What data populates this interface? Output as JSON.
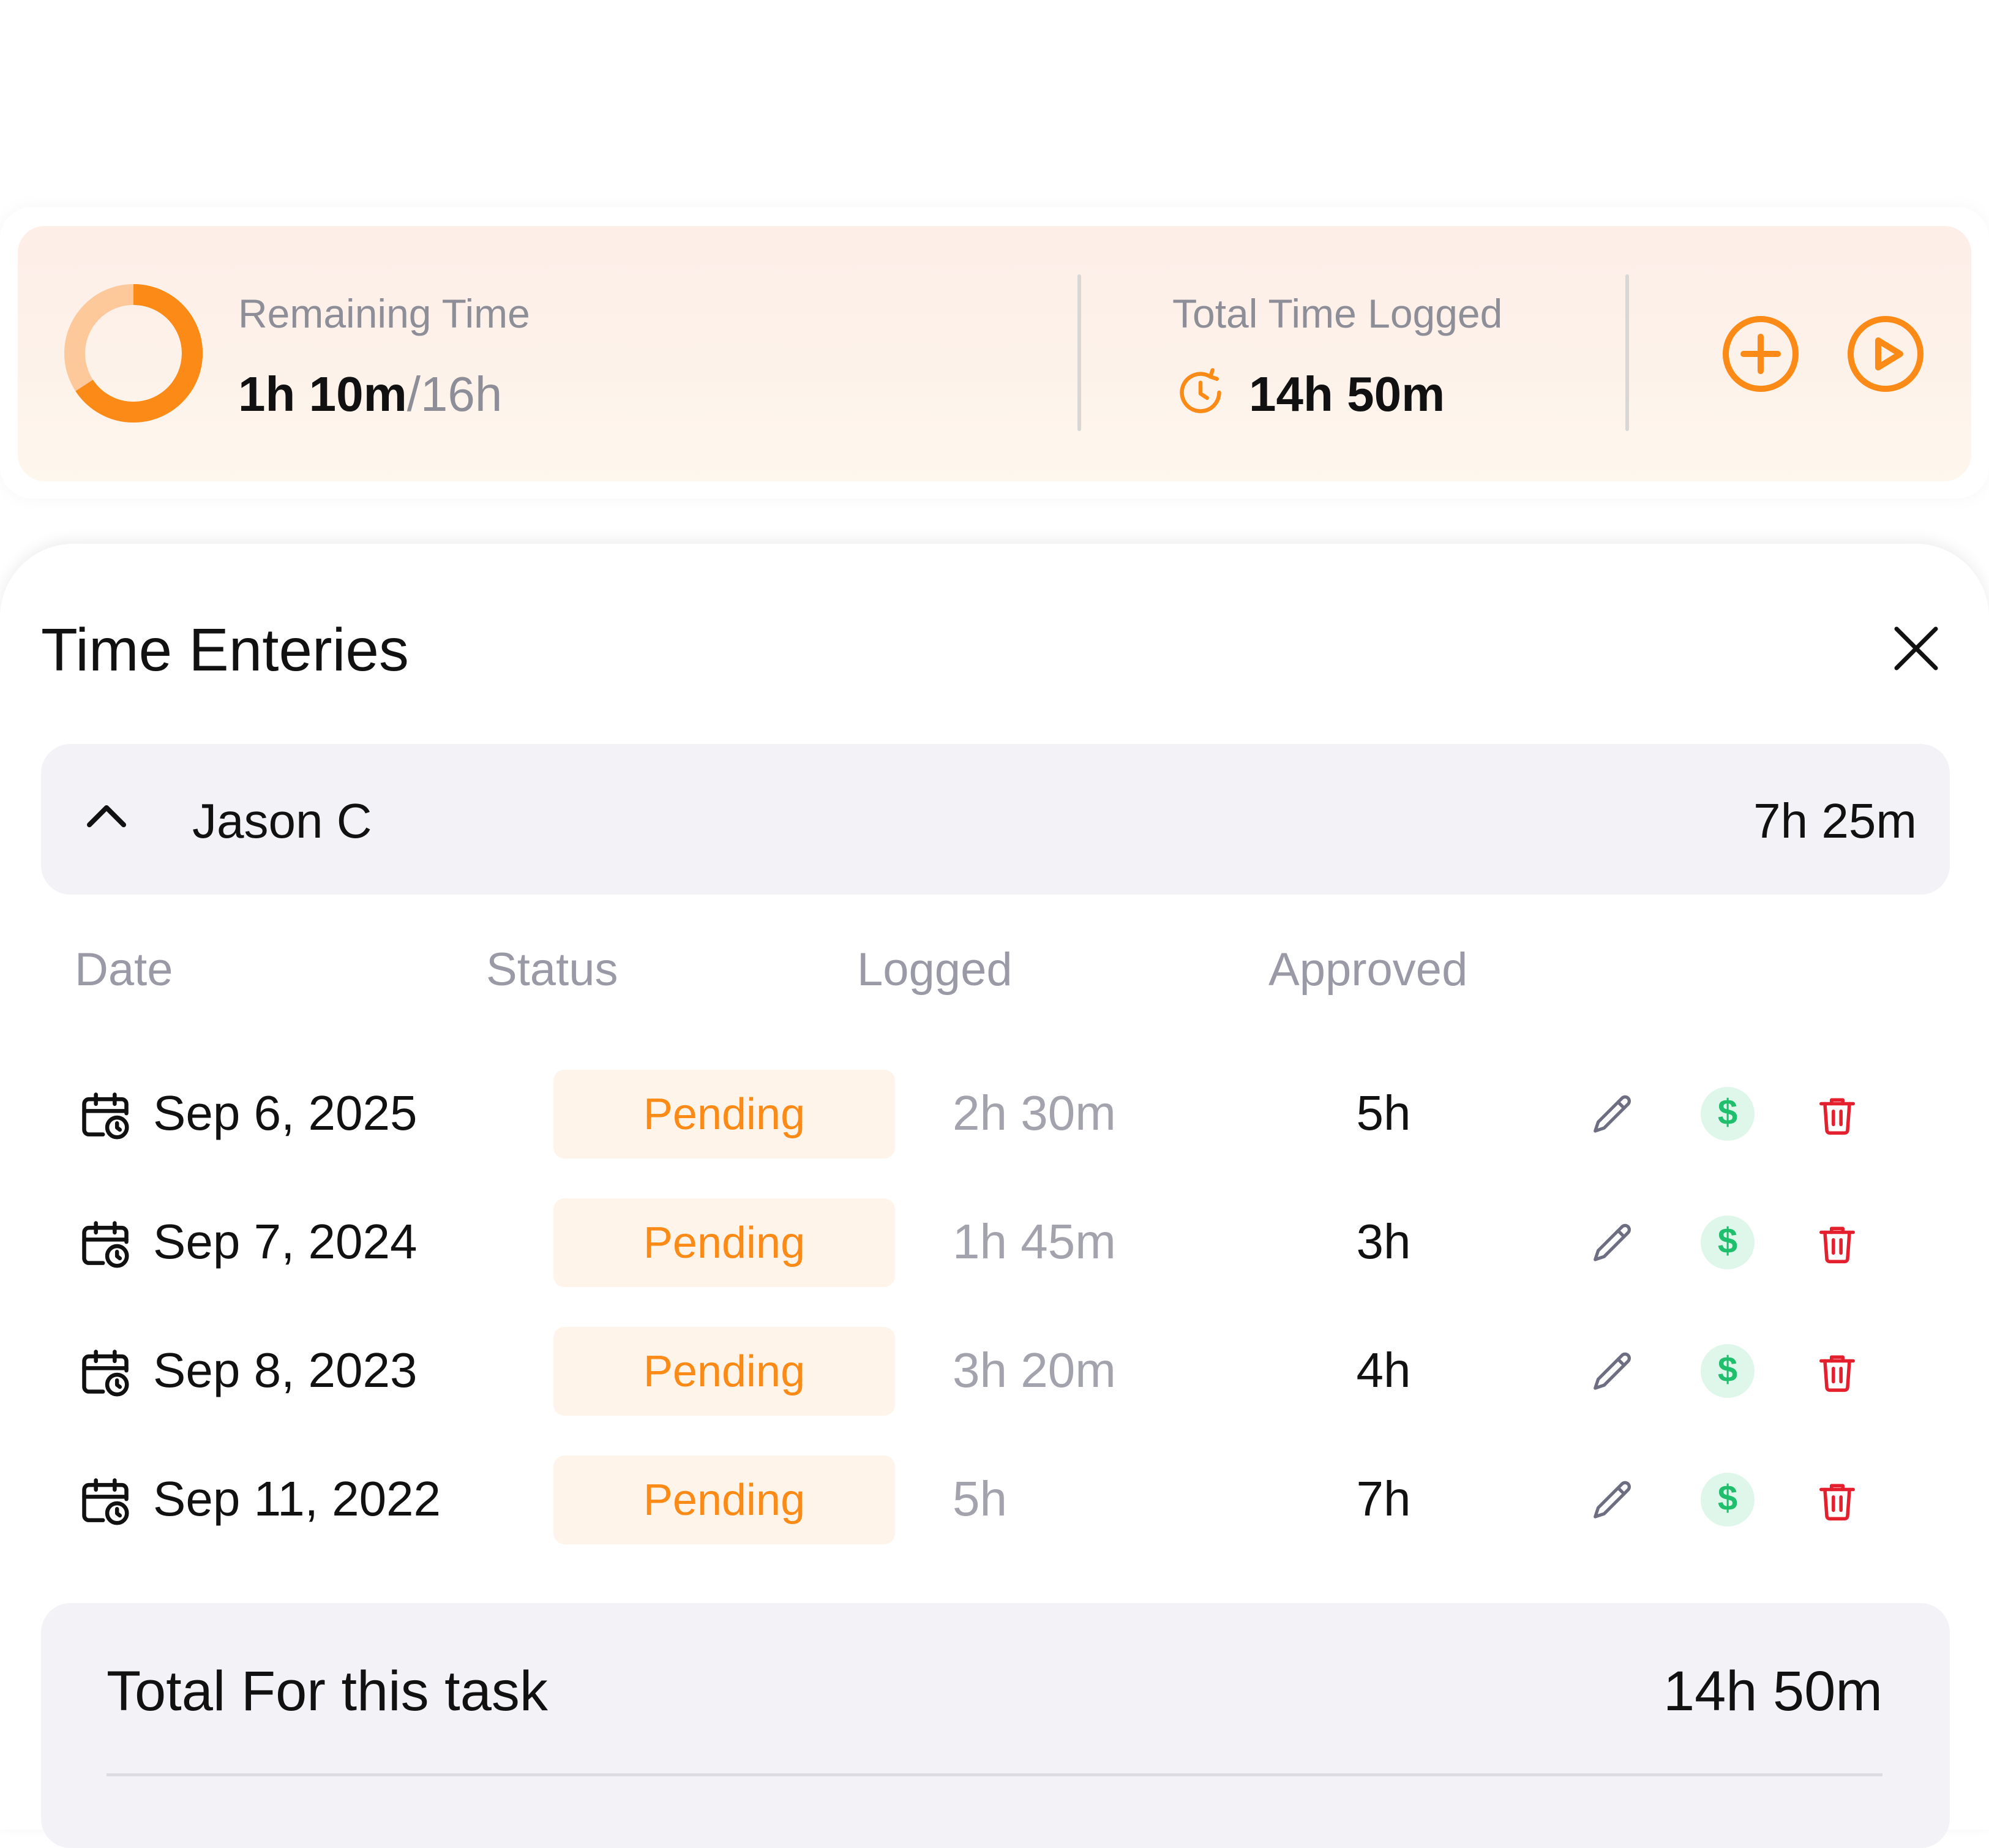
{
  "summary": {
    "remaining_label": "Remaining Time",
    "remaining_value": "1h 10m",
    "remaining_total": "/16h",
    "remaining_fraction": 0.073,
    "logged_label": "Total Time Logged",
    "logged_value": "14h 50m",
    "actions": {
      "add_icon": "plus-circle-icon",
      "play_icon": "play-circle-icon"
    }
  },
  "sheet": {
    "title": "Time Enteries",
    "close_icon": "close-icon"
  },
  "group": {
    "name": "Jason C",
    "total": "7h 25m",
    "expanded": true
  },
  "columns": [
    "Date",
    "Status",
    "Logged",
    "Approved"
  ],
  "entries": [
    {
      "date": "Sep 6, 2025",
      "status": "Pending",
      "logged": "2h 30m",
      "approved": "5h"
    },
    {
      "date": "Sep 7, 2024",
      "status": "Pending",
      "logged": "1h 45m",
      "approved": "3h"
    },
    {
      "date": "Sep 8, 2023",
      "status": "Pending",
      "logged": "3h 20m",
      "approved": "4h"
    },
    {
      "date": "Sep 11, 2022",
      "status": "Pending",
      "logged": "5h",
      "approved": "7h"
    }
  ],
  "total": {
    "label": "Total For this task",
    "value": "14h 50m"
  },
  "colors": {
    "accent": "#fb8a16",
    "accent_light": "#fdc89a",
    "pill_bg": "#fef4ea",
    "billable_green": "#1fbf6e",
    "billable_bg": "#dff7ea",
    "delete_red": "#e5202e",
    "edit_gray": "#6e6e82"
  }
}
